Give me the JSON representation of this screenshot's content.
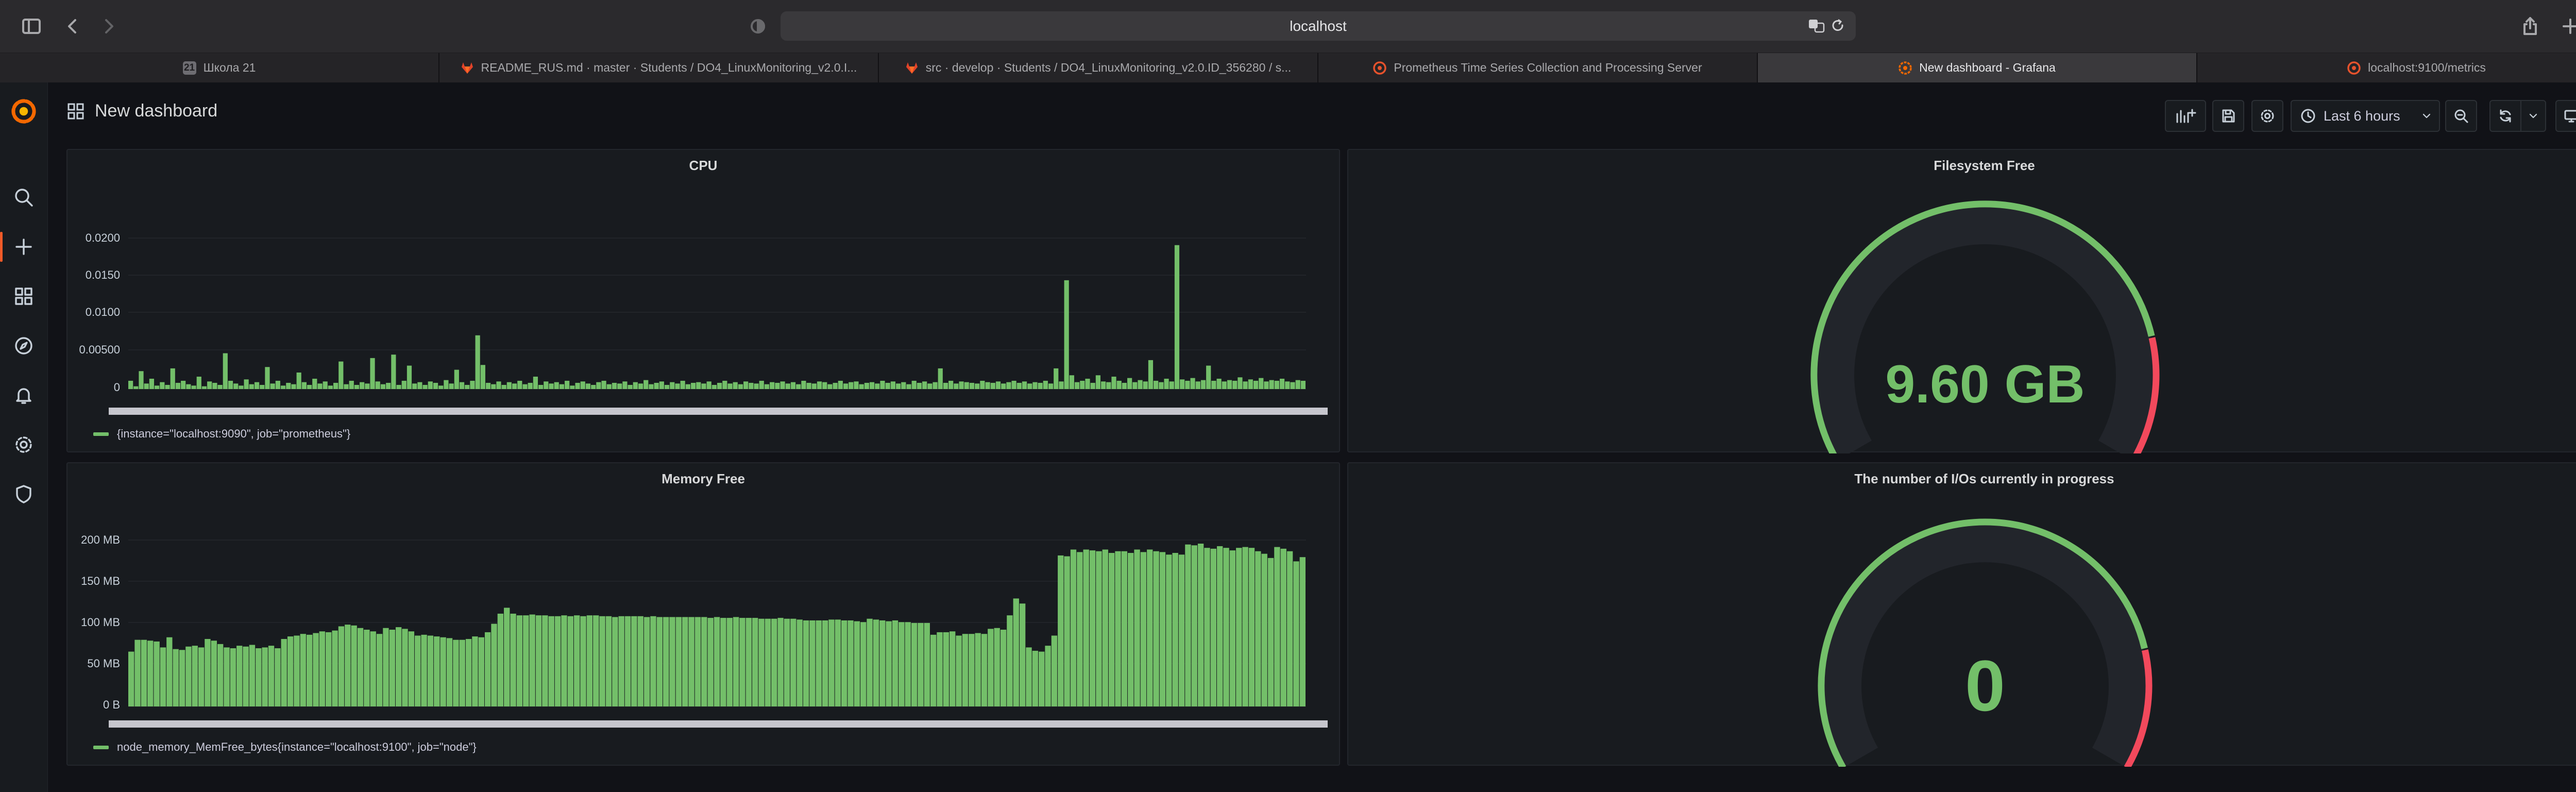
{
  "browser": {
    "url": "localhost",
    "tabs": [
      {
        "label": "Школа 21",
        "icon": "school-21-badge",
        "badge": "21"
      },
      {
        "label": "README_RUS.md · master · Students / DO4_LinuxMonitoring_v2.0.I...",
        "icon": "gitlab-icon"
      },
      {
        "label": "src · develop · Students / DO4_LinuxMonitoring_v2.0.ID_356280 / s...",
        "icon": "gitlab-icon"
      },
      {
        "label": "Prometheus Time Series Collection and Processing Server",
        "icon": "prometheus-icon"
      },
      {
        "label": "New dashboard - Grafana",
        "icon": "grafana-icon",
        "active": true
      },
      {
        "label": "localhost:9100/metrics",
        "icon": "prometheus-icon"
      }
    ]
  },
  "sidebar": {
    "items": [
      "search",
      "create",
      "dashboards",
      "explore",
      "alerting",
      "configuration",
      "server-admin"
    ]
  },
  "dashboard": {
    "title": "New dashboard",
    "time_range": "Last 6 hours"
  },
  "colors": {
    "series": "#73bf69",
    "threshold_red": "#f2495c",
    "accent": "#f05a28"
  },
  "panels": {
    "cpu": {
      "title": "CPU",
      "legend": "{instance=\"localhost:9090\", job=\"prometheus\"}",
      "yticks": [
        "0.0200",
        "0.0150",
        "0.0100",
        "0.00500",
        "0"
      ]
    },
    "filesystem": {
      "title": "Filesystem Free",
      "value": "9.60 GB"
    },
    "memory": {
      "title": "Memory Free",
      "legend": "node_memory_MemFree_bytes{instance=\"localhost:9100\", job=\"node\"}",
      "yticks": [
        "200 MB",
        "150 MB",
        "100 MB",
        "50 MB",
        "0 B"
      ]
    },
    "ios": {
      "title": "The number of I/Os currently in progress",
      "value": "0"
    }
  },
  "chart_data": [
    {
      "type": "bar",
      "title": "CPU",
      "ylim": [
        0,
        0.022
      ],
      "series": [
        {
          "name": "{instance=\"localhost:9090\", job=\"prometheus\"}",
          "color": "#73bf69",
          "values": [
            0.0012,
            0.0004,
            0.0026,
            0.0008,
            0.0015,
            0.0005,
            0.001,
            0.0006,
            0.003,
            0.0009,
            0.0012,
            0.0007,
            0.0005,
            0.0018,
            0.0004,
            0.0011,
            0.0009,
            0.0006,
            0.0052,
            0.0012,
            0.0008,
            0.0005,
            0.0014,
            0.0007,
            0.001,
            0.0006,
            0.0032,
            0.0008,
            0.0012,
            0.0005,
            0.0009,
            0.0007,
            0.0024,
            0.001,
            0.0006,
            0.0015,
            0.0008,
            0.0011,
            0.0005,
            0.0009,
            0.004,
            0.0007,
            0.0012,
            0.0006,
            0.001,
            0.0008,
            0.0045,
            0.0011,
            0.0007,
            0.0009,
            0.005,
            0.0006,
            0.0012,
            0.0034,
            0.0008,
            0.001,
            0.0006,
            0.0011,
            0.0009,
            0.0005,
            0.0013,
            0.0008,
            0.0028,
            0.001,
            0.0006,
            0.0012,
            0.0078,
            0.0035,
            0.0009,
            0.0007,
            0.0011,
            0.0006,
            0.001,
            0.0008,
            0.0012,
            0.0007,
            0.0009,
            0.0018,
            0.0006,
            0.0011,
            0.0008,
            0.001,
            0.0007,
            0.0012,
            0.0005,
            0.0009,
            0.0011,
            0.0008,
            0.0006,
            0.001,
            0.0012,
            0.0007,
            0.0009,
            0.0008,
            0.0011,
            0.0006,
            0.001,
            0.0008,
            0.0013,
            0.0007,
            0.0009,
            0.0011,
            0.0006,
            0.001,
            0.0008,
            0.0012,
            0.0007,
            0.0009,
            0.001,
            0.0008,
            0.0011,
            0.0006,
            0.0009,
            0.0012,
            0.0008,
            0.001,
            0.0007,
            0.0011,
            0.0009,
            0.0008,
            0.0012,
            0.0007,
            0.001,
            0.0009,
            0.0011,
            0.0008,
            0.001,
            0.0007,
            0.0012,
            0.0009,
            0.0008,
            0.0011,
            0.001,
            0.0007,
            0.0009,
            0.0012,
            0.0008,
            0.001,
            0.0011,
            0.0007,
            0.0009,
            0.001,
            0.0008,
            0.0012,
            0.0009,
            0.0011,
            0.0008,
            0.001,
            0.0007,
            0.0012,
            0.0009,
            0.0011,
            0.0008,
            0.001,
            0.003,
            0.0009,
            0.0012,
            0.0008,
            0.0011,
            0.001,
            0.0009,
            0.0008,
            0.0012,
            0.001,
            0.0009,
            0.0011,
            0.0008,
            0.001,
            0.0012,
            0.0009,
            0.0011,
            0.0008,
            0.001,
            0.0009,
            0.0012,
            0.0008,
            0.003,
            0.0011,
            0.0158,
            0.002,
            0.001,
            0.0012,
            0.0015,
            0.0009,
            0.002,
            0.0011,
            0.001,
            0.0018,
            0.0012,
            0.0009,
            0.0016,
            0.001,
            0.0013,
            0.0011,
            0.0042,
            0.0012,
            0.001,
            0.0015,
            0.0011,
            0.0209,
            0.0014,
            0.0012,
            0.0016,
            0.0011,
            0.0013,
            0.0034,
            0.0012,
            0.0015,
            0.0011,
            0.0013,
            0.0012,
            0.0017,
            0.0011,
            0.0014,
            0.0012,
            0.0016,
            0.0011,
            0.0013,
            0.0012,
            0.0015,
            0.0011,
            0.001,
            0.0013,
            0.0012
          ]
        }
      ]
    },
    {
      "type": "bar",
      "title": "Memory Free",
      "ylim": [
        0,
        215
      ],
      "ylabel": "MB",
      "series": [
        {
          "name": "node_memory_MemFree_bytes{instance=\"localhost:9100\", job=\"node\"}",
          "color": "#73bf69",
          "values": [
            65,
            79,
            79,
            78,
            77,
            70,
            82,
            68,
            67,
            71,
            72,
            70,
            80,
            78,
            74,
            70,
            69,
            72,
            71,
            73,
            69,
            70,
            72,
            69,
            80,
            83,
            84,
            86,
            85,
            87,
            89,
            88,
            90,
            95,
            97,
            96,
            93,
            91,
            89,
            86,
            93,
            91,
            94,
            92,
            89,
            84,
            85,
            84,
            83,
            82,
            81,
            79,
            79,
            80,
            83,
            82,
            88,
            98,
            110,
            117,
            110,
            108,
            108,
            109,
            108,
            108,
            107,
            107,
            108,
            107,
            108,
            107,
            108,
            108,
            107,
            107,
            106,
            107,
            107,
            107,
            107,
            106,
            107,
            106,
            106,
            106,
            106,
            106,
            106,
            106,
            106,
            105,
            106,
            105,
            105,
            106,
            105,
            105,
            105,
            104,
            104,
            104,
            105,
            104,
            104,
            103,
            102,
            102,
            102,
            102,
            103,
            103,
            102,
            102,
            101,
            100,
            104,
            103,
            102,
            101,
            102,
            100,
            100,
            99,
            99,
            99,
            85,
            88,
            88,
            89,
            84,
            86,
            86,
            87,
            86,
            92,
            93,
            91,
            108,
            128,
            122,
            70,
            66,
            65,
            72,
            84,
            179,
            178,
            186,
            183,
            186,
            185,
            184,
            186,
            182,
            184,
            184,
            182,
            186,
            183,
            186,
            184,
            183,
            180,
            182,
            180,
            192,
            191,
            193,
            188,
            187,
            190,
            188,
            185,
            188,
            189,
            188,
            184,
            181,
            176,
            189,
            187,
            184,
            172,
            177
          ]
        }
      ]
    },
    {
      "type": "gauge",
      "title": "Filesystem Free",
      "value": 9.6,
      "unit": "GB",
      "fraction": 0.82
    },
    {
      "type": "gauge",
      "title": "The number of I/Os currently in progress",
      "value": 0,
      "fraction": 0.82
    }
  ]
}
